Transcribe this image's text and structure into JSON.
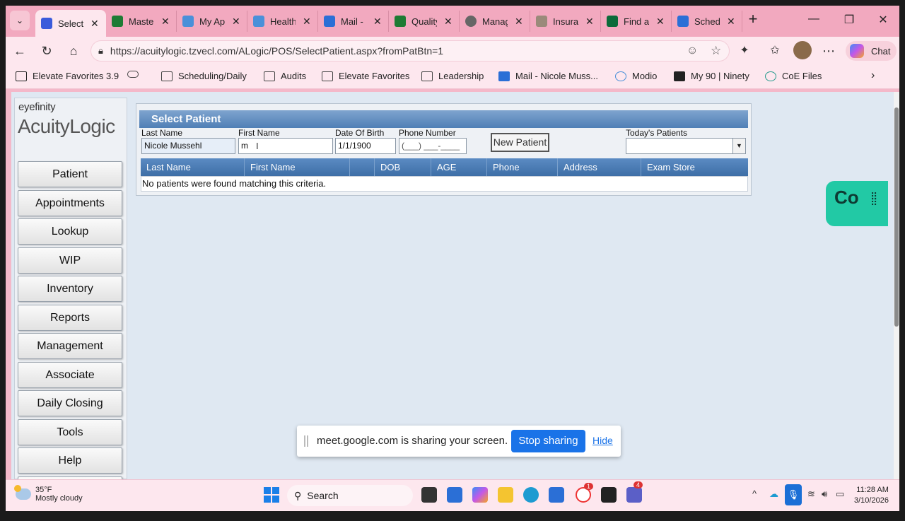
{
  "browser": {
    "tabs": [
      {
        "label": "Select P",
        "favicon_color": "#3b5bdb",
        "active": true
      },
      {
        "label": "Master",
        "favicon_color": "#1e7b34"
      },
      {
        "label": "My Ap",
        "favicon_color": "#4a90d9"
      },
      {
        "label": "Health",
        "favicon_color": "#4a90d9"
      },
      {
        "label": "Mail - N",
        "favicon_color": "#2b6fd6"
      },
      {
        "label": "Quality",
        "favicon_color": "#1e7b34"
      },
      {
        "label": "Manag",
        "favicon_color": "#666666"
      },
      {
        "label": "Insura",
        "favicon_color": "#9a8a7a"
      },
      {
        "label": "Find a",
        "favicon_color": "#0b6b3a"
      },
      {
        "label": "Schedu",
        "favicon_color": "#2b6fd6"
      }
    ],
    "new_tab_symbol": "+",
    "url": "https://acuitylogic.tzvecl.com/ALogic/POS/SelectPatient.aspx?fromPatBtn=1",
    "chat_label": "Chat",
    "bookmarks": [
      "Elevate Favorites 3.9",
      "Scheduling/Daily",
      "Audits",
      "Elevate Favorites",
      "Leadership",
      "Mail - Nicole Muss...",
      "Modio",
      "My 90 | Ninety",
      "CoE Files"
    ]
  },
  "app": {
    "brand_small": "eyefinity",
    "brand_large": "AcuityLogic",
    "nav": [
      "Patient",
      "Appointments",
      "Lookup",
      "WIP",
      "Inventory",
      "Reports",
      "Management",
      "Associate",
      "Daily Closing",
      "Tools",
      "Help"
    ],
    "panel_title": "Select Patient",
    "fields": {
      "last_name": {
        "label": "Last Name",
        "value": "Nicole Mussehl"
      },
      "first_name": {
        "label": "First Name",
        "value": "m"
      },
      "dob": {
        "label": "Date Of Birth",
        "value": "1/1/1900"
      },
      "phone": {
        "label": "Phone Number",
        "value": "(___) ___-____"
      },
      "todays_patients": {
        "label": "Today's Patients",
        "value": ""
      }
    },
    "new_patient_label": "New Patient",
    "grid_columns": [
      "Last Name",
      "First Name",
      "DOB",
      "AGE",
      "Phone",
      "Address",
      "Exam Store"
    ],
    "empty_message": "No patients were found matching this criteria."
  },
  "widget": {
    "label": "Co"
  },
  "sharebar": {
    "message": "meet.google.com is sharing your screen.",
    "stop_label": "Stop sharing",
    "hide_label": "Hide"
  },
  "taskbar": {
    "temp": "35°F",
    "weather": "Mostly cloudy",
    "search_label": "Search",
    "time": "11:28 AM",
    "date": "3/10/2026",
    "badge_1": "1",
    "badge_2": "4"
  }
}
